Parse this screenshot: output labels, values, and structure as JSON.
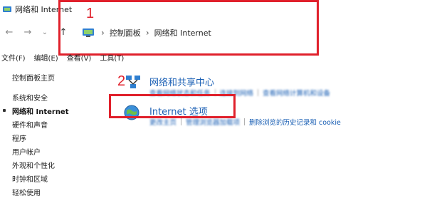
{
  "window": {
    "title": "网络和 Internet"
  },
  "toolbar": {
    "back": "←",
    "forward": "→",
    "recent": "⌄",
    "up": "↑",
    "breadcrumb": [
      "控制面板",
      "网络和 Internet"
    ]
  },
  "annotations": {
    "one": "1",
    "two": "2"
  },
  "menu": [
    "文件(F)",
    "编辑(E)",
    "查看(V)",
    "工具(T)"
  ],
  "sidebar": {
    "home": "控制面板主页",
    "items": [
      {
        "label": "系统和安全"
      },
      {
        "label": "网络和 Internet"
      },
      {
        "label": "硬件和声音"
      },
      {
        "label": "程序"
      },
      {
        "label": "用户帐户"
      },
      {
        "label": "外观和个性化"
      },
      {
        "label": "时钟和区域"
      },
      {
        "label": "轻松使用"
      }
    ]
  },
  "main": {
    "categories": [
      {
        "title": "网络和共享中心",
        "links": [
          "查看网络状态和任务",
          "连接到网络",
          "查看网络计算机和设备"
        ]
      },
      {
        "title": "Internet 选项",
        "links": [
          "更改主页",
          "管理浏览器加载项",
          "删除浏览的历史记录和 cookie"
        ]
      }
    ]
  },
  "colors": {
    "annotation_red": "#e0202b",
    "link_blue": "#1a5fb4"
  }
}
